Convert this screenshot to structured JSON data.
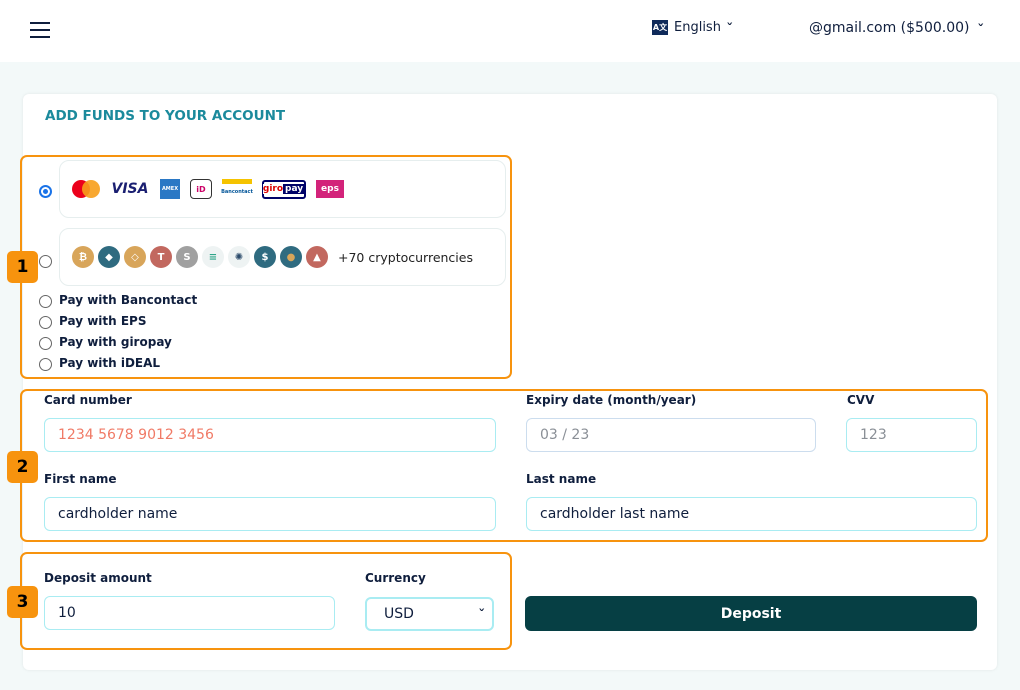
{
  "header": {
    "language": "English",
    "account": "@gmail.com ($500.00)"
  },
  "title": "ADD FUNDS TO YOUR ACCOUNT",
  "badges": [
    "1",
    "2",
    "3"
  ],
  "payment": {
    "card_logos": [
      "Mastercard",
      "VISA",
      "American Express",
      "iDEAL",
      "Bancontact",
      "giropay",
      "eps"
    ],
    "cryptos": [
      "Bitcoin",
      "Ethereum",
      "BNB",
      "Tether",
      "Synthetix",
      "Solana",
      "Cardano",
      "USD Coin",
      "Terra",
      "Avalanche"
    ],
    "crypto_more": "+70 cryptocurrencies",
    "options": [
      "Pay with Bancontact",
      "Pay with EPS",
      "Pay with giropay",
      "Pay with iDEAL"
    ],
    "selected": "card"
  },
  "form": {
    "card_number_label": "Card number",
    "card_number_value": "1234 5678 9012 3456",
    "expiry_label": "Expiry date (month/year)",
    "expiry_placeholder": "03 / 23",
    "cvv_label": "CVV",
    "cvv_placeholder": "123",
    "first_name_label": "First name",
    "first_name_value": "cardholder name",
    "last_name_label": "Last name",
    "last_name_value": "cardholder last name",
    "deposit_label": "Deposit amount",
    "deposit_value": "10",
    "currency_label": "Currency",
    "currency_value": "USD",
    "deposit_button": "Deposit"
  },
  "colors": {
    "accent": "#f7930e",
    "title": "#1b8a9c",
    "button": "#063f44",
    "card_value": "#f07a66"
  }
}
